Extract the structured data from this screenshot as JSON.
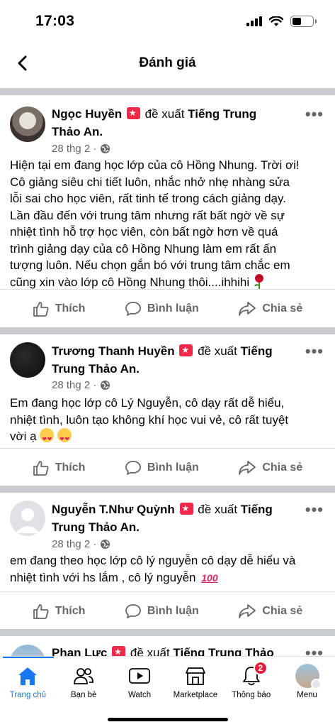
{
  "status": {
    "time": "17:03"
  },
  "header": {
    "title": "Đánh giá"
  },
  "actions": {
    "like": "Thích",
    "comment": "Bình luận",
    "share": "Chia sẻ"
  },
  "posts": [
    {
      "name": "Ngọc Huyền",
      "verb": "đề xuất",
      "page_line1": "Tiếng Trung",
      "page_line2": "Thảo An.",
      "date": "28 thg 2 ·",
      "lines": [
        "Hiện tại em đang học lớp của cô Hồng Nhung. Trời ơi!",
        "Cô giảng siêu chi tiết luôn, nhắc nhở nhẹ nhàng sửa",
        "lỗi sai cho học viên, rất tinh tế trong cách giảng dạy.",
        "Lần đầu đến với trung tâm nhưng rất bất ngờ về sự",
        "nhiệt tình hỗ trợ học viên, còn bất ngờ hơn về quá",
        "trình giảng dạy của cô Hồng Nhung làm em rất ấn",
        "tượng luôn. Nếu chọn gắn bó với trung tâm chắc em",
        "cũng xin vào lớp cô Hồng Nhung thôi....ihhihi"
      ],
      "trailing_emoji": "rose"
    },
    {
      "name": "Trương Thanh Huyền",
      "verb": "đề xuất",
      "page_line1": "Tiếng",
      "page_line2": "Trung Thảo An.",
      "date": "28 thg 2 ·",
      "lines": [
        "Em đang học lớp cô Lý Nguyễn, cô dạy rất dễ hiểu,",
        "nhiệt tình, luôn tạo không khí học vui vẻ, cô rất tuyệt",
        "vời ạ"
      ],
      "trailing_emoji": "heart-eyes x2"
    },
    {
      "name": "Nguyễn T.Như Quỳnh",
      "verb": "đề xuất",
      "page_line1": "Tiếng",
      "page_line2": "Trung Thảo An.",
      "date": "28 thg 2 ·",
      "lines": [
        "em đang theo học lớp cô lý nguyễn cô dạy dễ hiểu và",
        "nhiệt tình với hs  lắm , cô lý  nguyễn"
      ],
      "trailing_emoji": "100"
    },
    {
      "name": "Phan Lực",
      "verb": "đề xuất",
      "page_line1": "Tiếng Trung Thảo"
    }
  ],
  "tabs": [
    {
      "label": "Trang chủ",
      "icon": "home-icon",
      "active": true
    },
    {
      "label": "Bạn bè",
      "icon": "friends-icon"
    },
    {
      "label": "Watch",
      "icon": "watch-icon"
    },
    {
      "label": "Marketplace",
      "icon": "marketplace-icon"
    },
    {
      "label": "Thông báo",
      "icon": "bell-icon",
      "badge": "2"
    },
    {
      "label": "Menu",
      "icon": "menu-avatar-icon"
    }
  ],
  "colors": {
    "accent": "#1877f2",
    "badge": "#e41e3f",
    "secondary_text": "#65676b",
    "divider": "#c9ccd1"
  }
}
